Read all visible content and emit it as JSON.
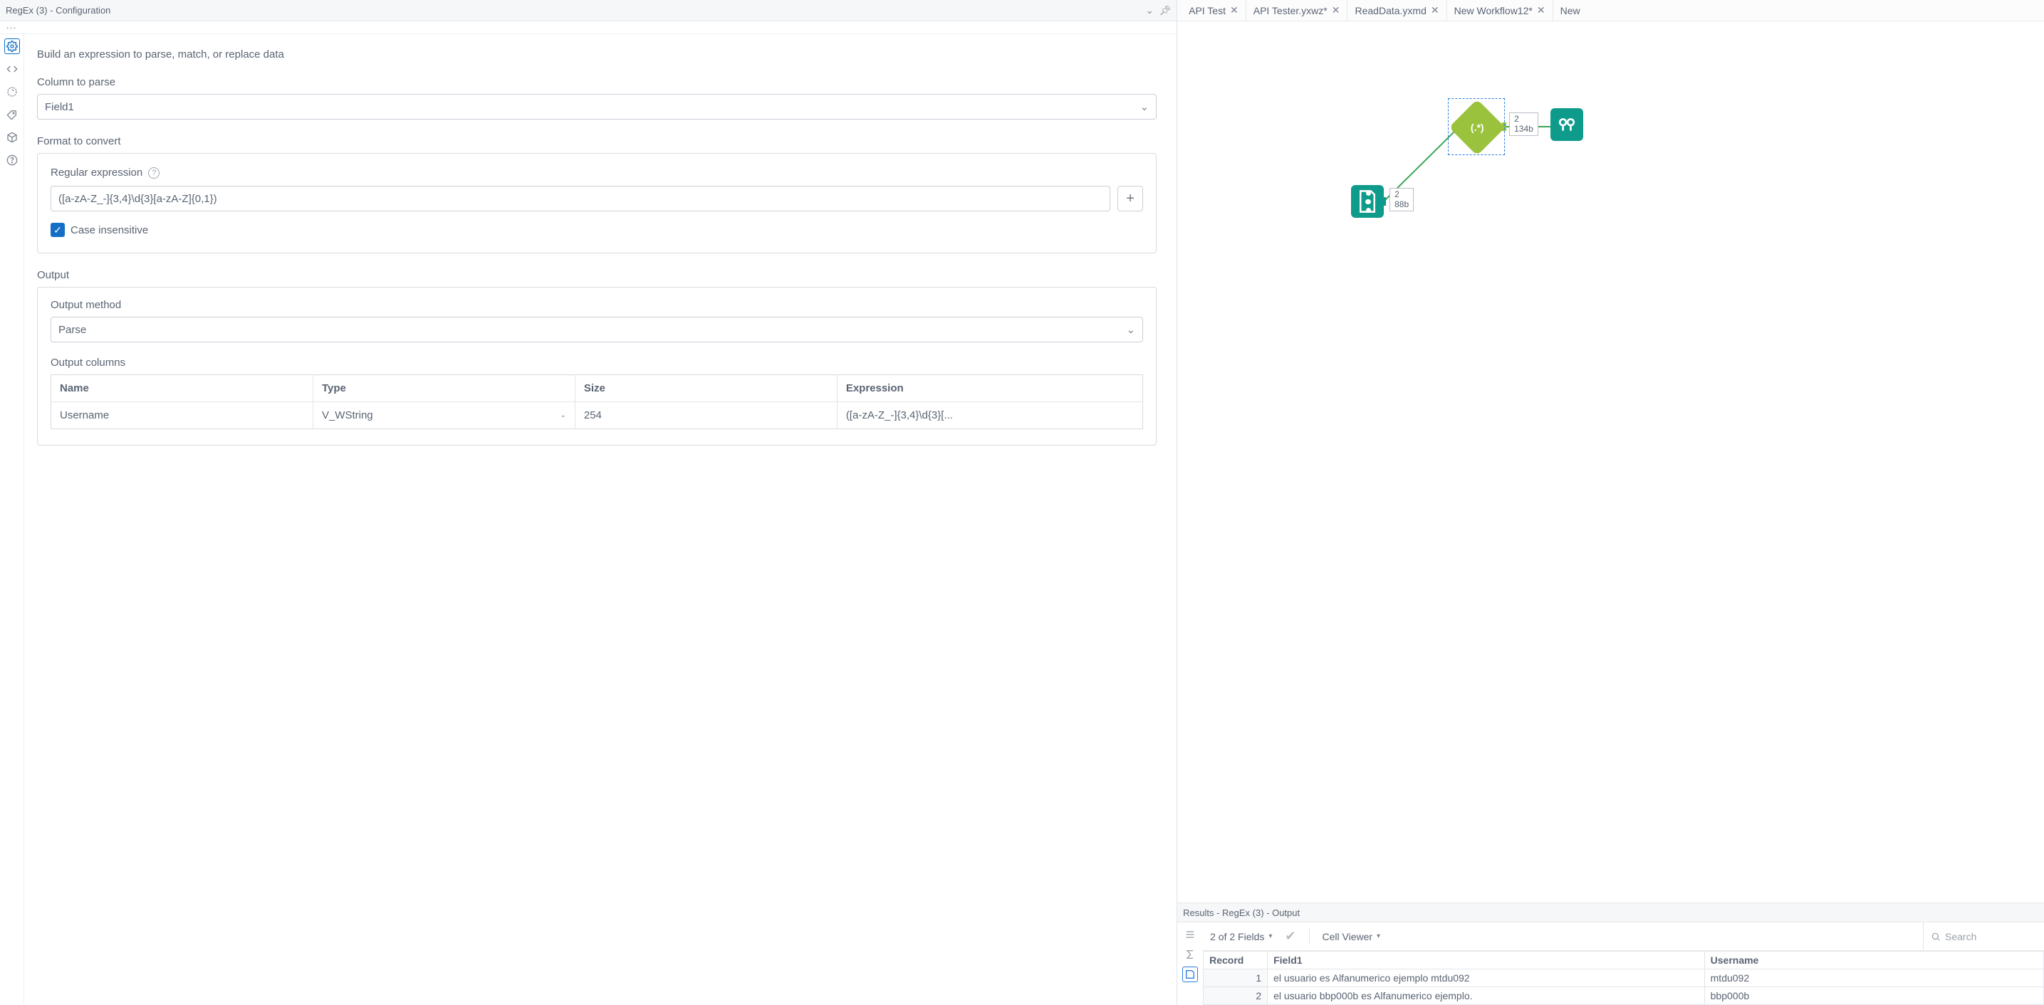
{
  "config_panel": {
    "title": "RegEx (3) - Configuration",
    "subtitle": "Build an expression to parse, match, or replace data",
    "column_to_parse_label": "Column to parse",
    "column_to_parse_value": "Field1",
    "format_label": "Format to convert",
    "regex_label": "Regular expression",
    "regex_value": "([a-zA-Z_-]{3,4}\\d{3}[a-zA-Z]{0,1})",
    "case_insensitive_label": "Case insensitive",
    "case_insensitive_checked": true,
    "output_label": "Output",
    "output_method_label": "Output method",
    "output_method_value": "Parse",
    "output_columns_label": "Output columns",
    "output_columns_headers": [
      "Name",
      "Type",
      "Size",
      "Expression"
    ],
    "output_columns_rows": [
      {
        "name": "Username",
        "type": "V_WString",
        "size": "254",
        "expression": "([a-zA-Z_-]{3,4}\\d{3}[..."
      }
    ]
  },
  "side_tabs": [
    {
      "name": "gear-icon",
      "selected": true
    },
    {
      "name": "code-icon",
      "selected": false
    },
    {
      "name": "refresh-icon",
      "selected": false
    },
    {
      "name": "tag-icon",
      "selected": false
    },
    {
      "name": "package-icon",
      "selected": false
    },
    {
      "name": "help-icon",
      "selected": false
    }
  ],
  "tabs": [
    {
      "label": "API Test",
      "closeable": true
    },
    {
      "label": "API Tester.yxwz*",
      "closeable": true
    },
    {
      "label": "ReadData.yxmd",
      "closeable": true
    },
    {
      "label": "New Workflow12*",
      "closeable": true
    },
    {
      "label": "New",
      "closeable": false
    }
  ],
  "canvas": {
    "macro_anno": {
      "line1": "2",
      "line2": "88b"
    },
    "regex_anno": {
      "line1": "2",
      "line2": "134b"
    },
    "regex_glyph": "(.*)"
  },
  "results": {
    "title": "Results - RegEx (3) - Output",
    "fields_summary": "2 of 2 Fields",
    "cell_viewer_label": "Cell Viewer",
    "search_placeholder": "Search",
    "headers": [
      "Record",
      "Field1",
      "Username"
    ],
    "rows": [
      {
        "record": "1",
        "field1": "el usuario es Alfanumerico ejemplo mtdu092",
        "username": "mtdu092"
      },
      {
        "record": "2",
        "field1": "el usuario bbp000b es Alfanumerico ejemplo.",
        "username": "bbp000b"
      }
    ]
  }
}
